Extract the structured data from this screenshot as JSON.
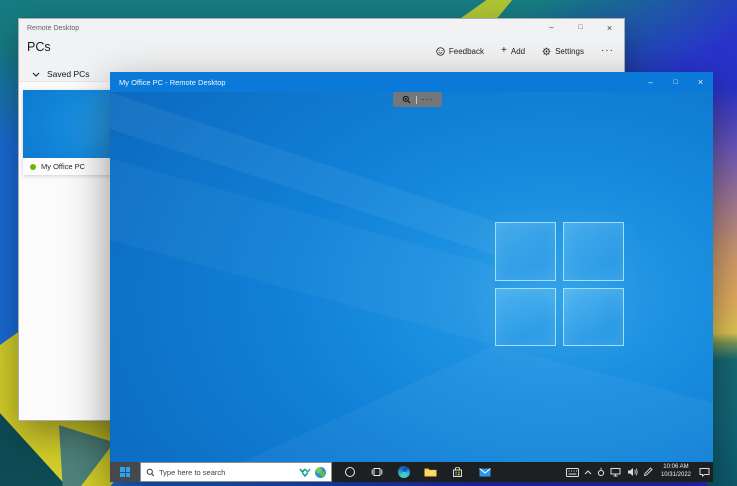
{
  "glyphs": {
    "minimize": "–",
    "maximize": "□",
    "close": "×",
    "more": "···",
    "add": "+"
  },
  "host_app": {
    "window_title": "Remote Desktop",
    "page_title": "PCs",
    "toolbar": {
      "feedback": "Feedback",
      "add": "Add",
      "settings": "Settings"
    },
    "saved_pcs_label": "Saved PCs",
    "pc_tile": {
      "name": "My Office PC",
      "status": "online"
    }
  },
  "remote_session": {
    "window_title": "My Office PC - Remote Desktop"
  },
  "taskbar": {
    "search_placeholder": "Type here to search",
    "clock": {
      "time": "10:06 AM",
      "date": "10/31/2022"
    },
    "app_icons": [
      "start",
      "cortana",
      "task-view",
      "edge",
      "file-explorer",
      "store",
      "mail"
    ],
    "search_icons": [
      "search-magnifier",
      "search-highlights",
      "globe"
    ],
    "tray_icons": [
      "touch-keyboard",
      "hidden-icons-chevron",
      "status",
      "network",
      "volume",
      "pen",
      "action-center"
    ]
  },
  "colors": {
    "remote_titlebar": "#0b79d7",
    "desktop_blue": "#0d72c8",
    "taskbar_bg": "#1d2023",
    "status_green": "#6bb700",
    "start_logo_blue": "#2aa4f5",
    "app_bg": "#f1f2f3"
  }
}
